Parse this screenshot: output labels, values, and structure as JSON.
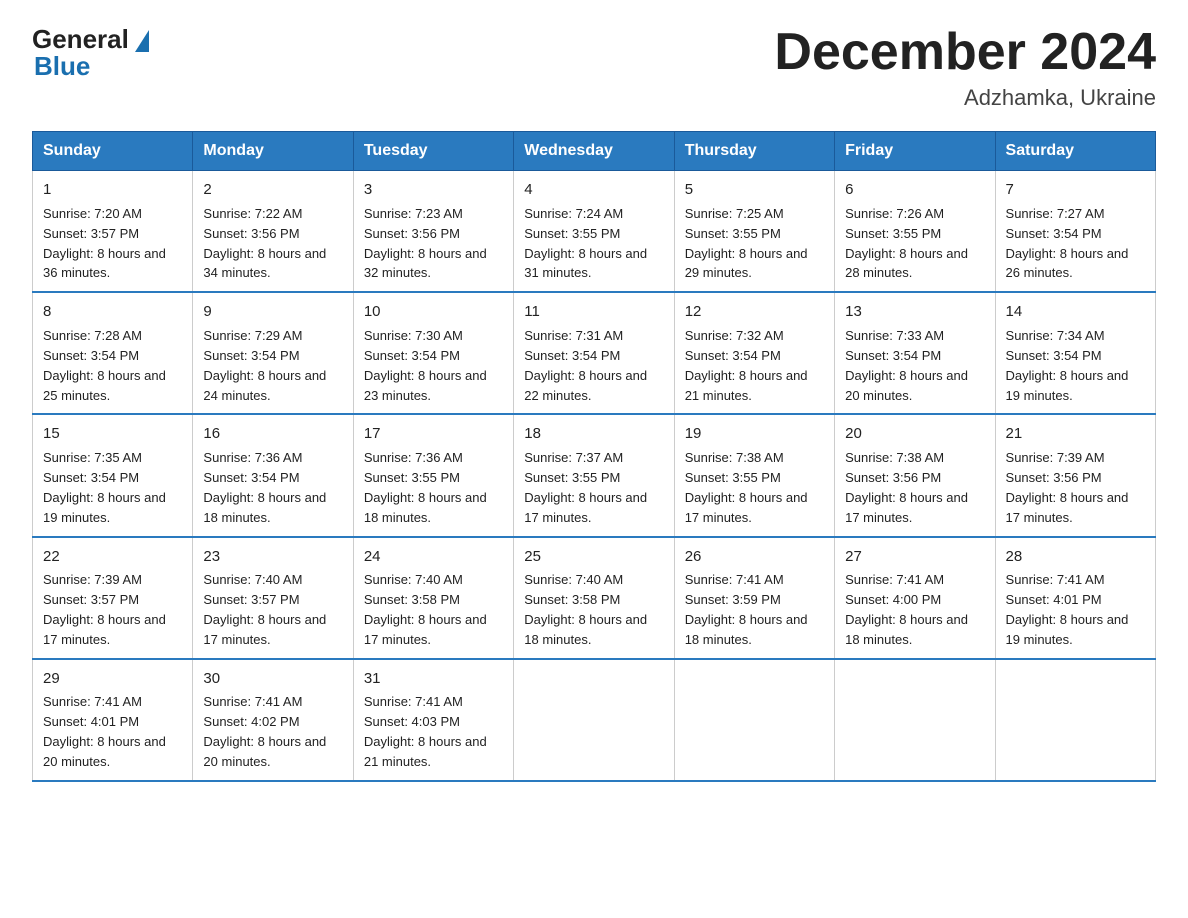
{
  "header": {
    "logo_general": "General",
    "logo_blue": "Blue",
    "month": "December 2024",
    "location": "Adzhamka, Ukraine"
  },
  "days_of_week": [
    "Sunday",
    "Monday",
    "Tuesday",
    "Wednesday",
    "Thursday",
    "Friday",
    "Saturday"
  ],
  "weeks": [
    [
      {
        "day": "1",
        "sunrise": "7:20 AM",
        "sunset": "3:57 PM",
        "daylight": "8 hours and 36 minutes."
      },
      {
        "day": "2",
        "sunrise": "7:22 AM",
        "sunset": "3:56 PM",
        "daylight": "8 hours and 34 minutes."
      },
      {
        "day": "3",
        "sunrise": "7:23 AM",
        "sunset": "3:56 PM",
        "daylight": "8 hours and 32 minutes."
      },
      {
        "day": "4",
        "sunrise": "7:24 AM",
        "sunset": "3:55 PM",
        "daylight": "8 hours and 31 minutes."
      },
      {
        "day": "5",
        "sunrise": "7:25 AM",
        "sunset": "3:55 PM",
        "daylight": "8 hours and 29 minutes."
      },
      {
        "day": "6",
        "sunrise": "7:26 AM",
        "sunset": "3:55 PM",
        "daylight": "8 hours and 28 minutes."
      },
      {
        "day": "7",
        "sunrise": "7:27 AM",
        "sunset": "3:54 PM",
        "daylight": "8 hours and 26 minutes."
      }
    ],
    [
      {
        "day": "8",
        "sunrise": "7:28 AM",
        "sunset": "3:54 PM",
        "daylight": "8 hours and 25 minutes."
      },
      {
        "day": "9",
        "sunrise": "7:29 AM",
        "sunset": "3:54 PM",
        "daylight": "8 hours and 24 minutes."
      },
      {
        "day": "10",
        "sunrise": "7:30 AM",
        "sunset": "3:54 PM",
        "daylight": "8 hours and 23 minutes."
      },
      {
        "day": "11",
        "sunrise": "7:31 AM",
        "sunset": "3:54 PM",
        "daylight": "8 hours and 22 minutes."
      },
      {
        "day": "12",
        "sunrise": "7:32 AM",
        "sunset": "3:54 PM",
        "daylight": "8 hours and 21 minutes."
      },
      {
        "day": "13",
        "sunrise": "7:33 AM",
        "sunset": "3:54 PM",
        "daylight": "8 hours and 20 minutes."
      },
      {
        "day": "14",
        "sunrise": "7:34 AM",
        "sunset": "3:54 PM",
        "daylight": "8 hours and 19 minutes."
      }
    ],
    [
      {
        "day": "15",
        "sunrise": "7:35 AM",
        "sunset": "3:54 PM",
        "daylight": "8 hours and 19 minutes."
      },
      {
        "day": "16",
        "sunrise": "7:36 AM",
        "sunset": "3:54 PM",
        "daylight": "8 hours and 18 minutes."
      },
      {
        "day": "17",
        "sunrise": "7:36 AM",
        "sunset": "3:55 PM",
        "daylight": "8 hours and 18 minutes."
      },
      {
        "day": "18",
        "sunrise": "7:37 AM",
        "sunset": "3:55 PM",
        "daylight": "8 hours and 17 minutes."
      },
      {
        "day": "19",
        "sunrise": "7:38 AM",
        "sunset": "3:55 PM",
        "daylight": "8 hours and 17 minutes."
      },
      {
        "day": "20",
        "sunrise": "7:38 AM",
        "sunset": "3:56 PM",
        "daylight": "8 hours and 17 minutes."
      },
      {
        "day": "21",
        "sunrise": "7:39 AM",
        "sunset": "3:56 PM",
        "daylight": "8 hours and 17 minutes."
      }
    ],
    [
      {
        "day": "22",
        "sunrise": "7:39 AM",
        "sunset": "3:57 PM",
        "daylight": "8 hours and 17 minutes."
      },
      {
        "day": "23",
        "sunrise": "7:40 AM",
        "sunset": "3:57 PM",
        "daylight": "8 hours and 17 minutes."
      },
      {
        "day": "24",
        "sunrise": "7:40 AM",
        "sunset": "3:58 PM",
        "daylight": "8 hours and 17 minutes."
      },
      {
        "day": "25",
        "sunrise": "7:40 AM",
        "sunset": "3:58 PM",
        "daylight": "8 hours and 18 minutes."
      },
      {
        "day": "26",
        "sunrise": "7:41 AM",
        "sunset": "3:59 PM",
        "daylight": "8 hours and 18 minutes."
      },
      {
        "day": "27",
        "sunrise": "7:41 AM",
        "sunset": "4:00 PM",
        "daylight": "8 hours and 18 minutes."
      },
      {
        "day": "28",
        "sunrise": "7:41 AM",
        "sunset": "4:01 PM",
        "daylight": "8 hours and 19 minutes."
      }
    ],
    [
      {
        "day": "29",
        "sunrise": "7:41 AM",
        "sunset": "4:01 PM",
        "daylight": "8 hours and 20 minutes."
      },
      {
        "day": "30",
        "sunrise": "7:41 AM",
        "sunset": "4:02 PM",
        "daylight": "8 hours and 20 minutes."
      },
      {
        "day": "31",
        "sunrise": "7:41 AM",
        "sunset": "4:03 PM",
        "daylight": "8 hours and 21 minutes."
      },
      null,
      null,
      null,
      null
    ]
  ]
}
